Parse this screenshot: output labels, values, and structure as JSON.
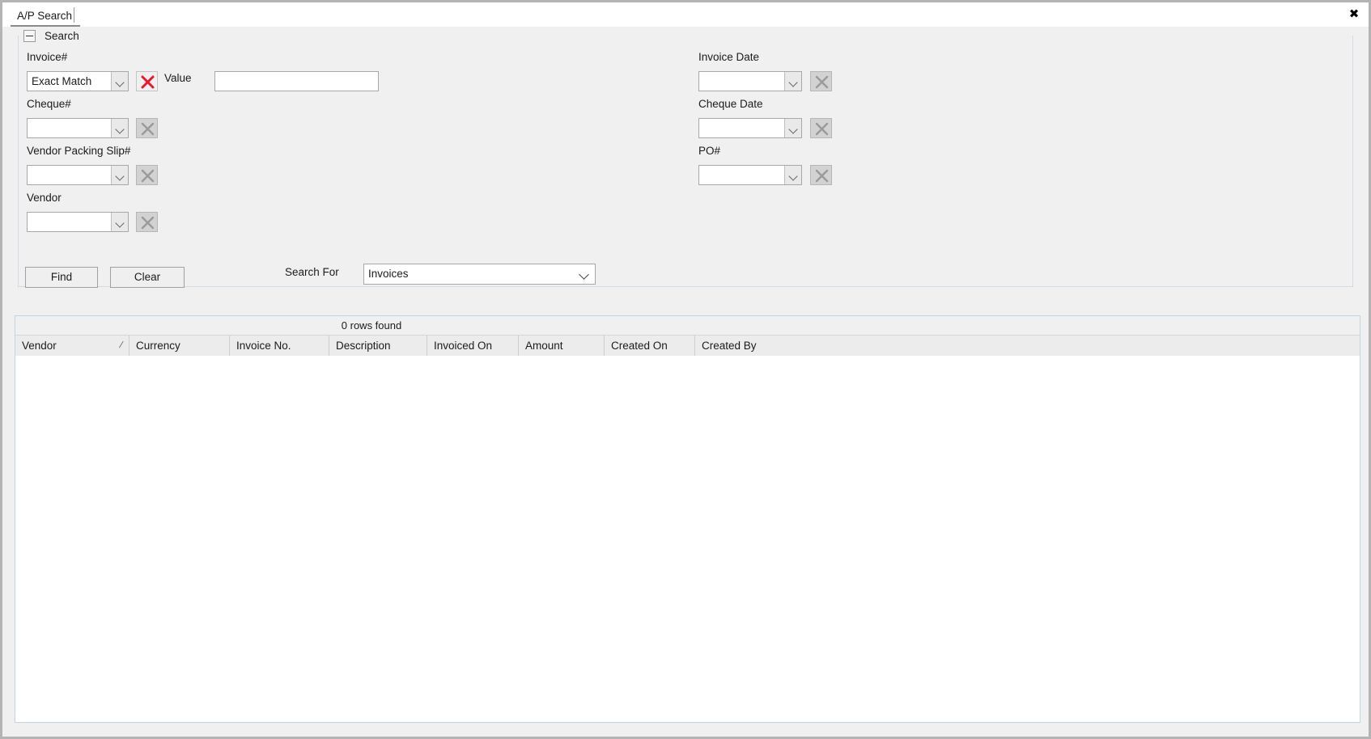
{
  "window": {
    "close_icon": "close-icon",
    "close_glyph": "✖"
  },
  "tabs": [
    {
      "label": "A/P Search",
      "active": true
    }
  ],
  "search_group": {
    "title": "Search",
    "collapse_icon": "minus-icon",
    "collapsed": false,
    "left_fields": [
      {
        "label": "Invoice#",
        "control": "combo",
        "value": "Exact Match",
        "clear_enabled": true,
        "has_value_input": true,
        "value_label": "Value",
        "value_text": "",
        "value_placeholder": ""
      },
      {
        "label": "Cheque#",
        "control": "combo",
        "value": "",
        "clear_enabled": false
      },
      {
        "label": "Vendor Packing Slip#",
        "control": "combo",
        "value": "",
        "clear_enabled": false
      },
      {
        "label": "Vendor",
        "control": "combo",
        "value": "",
        "clear_enabled": false
      }
    ],
    "right_fields": [
      {
        "label": "Invoice Date",
        "control": "combo",
        "value": "",
        "clear_enabled": false
      },
      {
        "label": "Cheque Date",
        "control": "combo",
        "value": "",
        "clear_enabled": false
      },
      {
        "label": "PO#",
        "control": "combo",
        "value": "",
        "clear_enabled": false
      }
    ],
    "buttons": {
      "find": "Find",
      "clear": "Clear"
    },
    "search_for": {
      "label": "Search For",
      "value": "Invoices",
      "options": [
        "Invoices"
      ]
    }
  },
  "results": {
    "rows_found_text": "0 rows found",
    "columns": [
      {
        "label": "Vendor",
        "sorted": true,
        "sort_glyph": "/"
      },
      {
        "label": "Currency",
        "sorted": false
      },
      {
        "label": "Invoice No.",
        "sorted": false
      },
      {
        "label": "Description",
        "sorted": false
      },
      {
        "label": "Invoiced On",
        "sorted": false
      },
      {
        "label": "Amount",
        "sorted": false
      },
      {
        "label": "Created On",
        "sorted": false
      },
      {
        "label": "Created By",
        "sorted": false
      }
    ],
    "rows": []
  },
  "colors": {
    "window_bg": "#f0f0f0",
    "panel_border": "#cfdbe5",
    "grid_header_bg": "#ececec",
    "clear_icon_active": "#e8172b",
    "clear_icon_disabled": "#9a9a9a",
    "text": "#1b1b1b"
  }
}
